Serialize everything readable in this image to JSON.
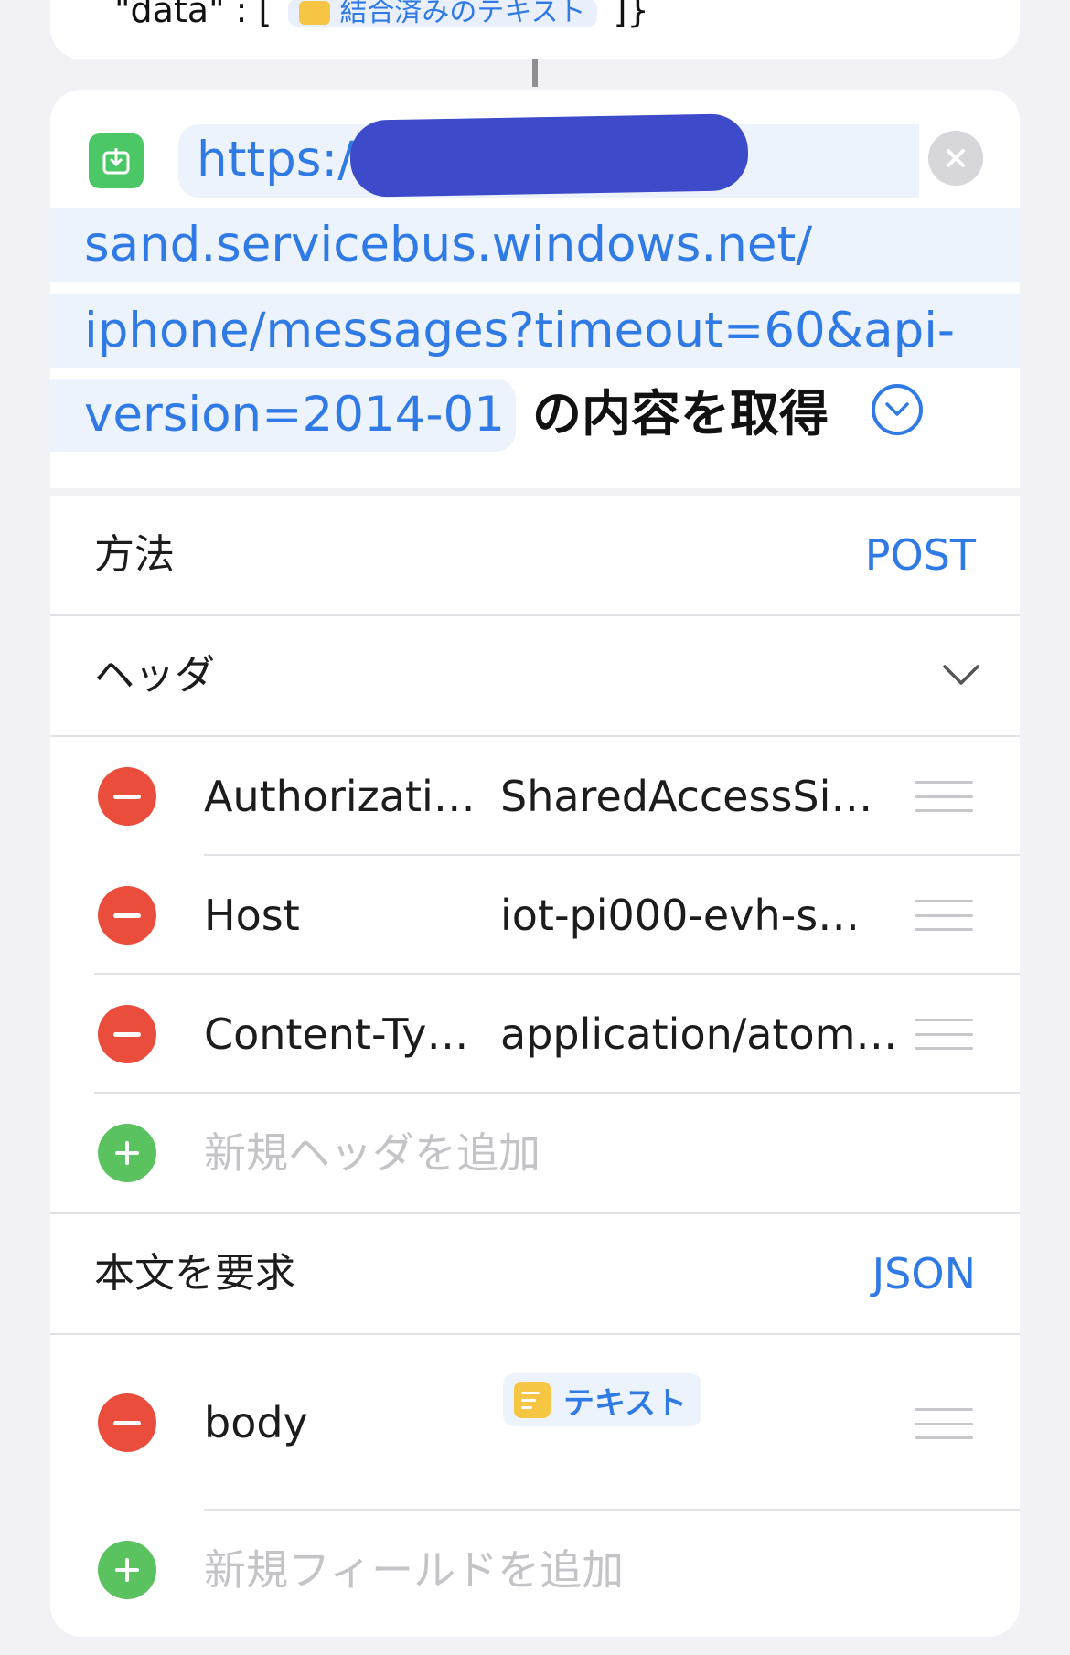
{
  "previous_action": {
    "text_prefix": "\"data\" : [",
    "token_label": "結合済みのテキスト",
    "text_suffix": "]}"
  },
  "action": {
    "url_line1": "https:/",
    "url_line2": "sand.servicebus.windows.net/",
    "url_line3": "iphone/messages?timeout=60&api-",
    "url_line4": "version=2014-01",
    "label": "の内容を取得",
    "icon": "download-icon"
  },
  "method": {
    "label": "方法",
    "value": "POST"
  },
  "headers": {
    "label": "ヘッダ",
    "items": [
      {
        "key": "Authorizati…",
        "value": "SharedAccessSi…"
      },
      {
        "key": "Host",
        "value": "iot-pi000-evh-s…"
      },
      {
        "key": "Content-Ty…",
        "value": "application/atom…"
      }
    ],
    "add_placeholder": "新規ヘッダを追加"
  },
  "request_body": {
    "label": "本文を要求",
    "value": "JSON",
    "fields": [
      {
        "key": "body",
        "token": "テキスト"
      }
    ],
    "add_placeholder": "新規フィールドを追加"
  },
  "colors": {
    "accent": "#2f7ae5",
    "remove": "#eb4d3d",
    "add": "#5ac25e",
    "token_bg": "#edf3fc",
    "redaction": "#3d4ac9"
  }
}
